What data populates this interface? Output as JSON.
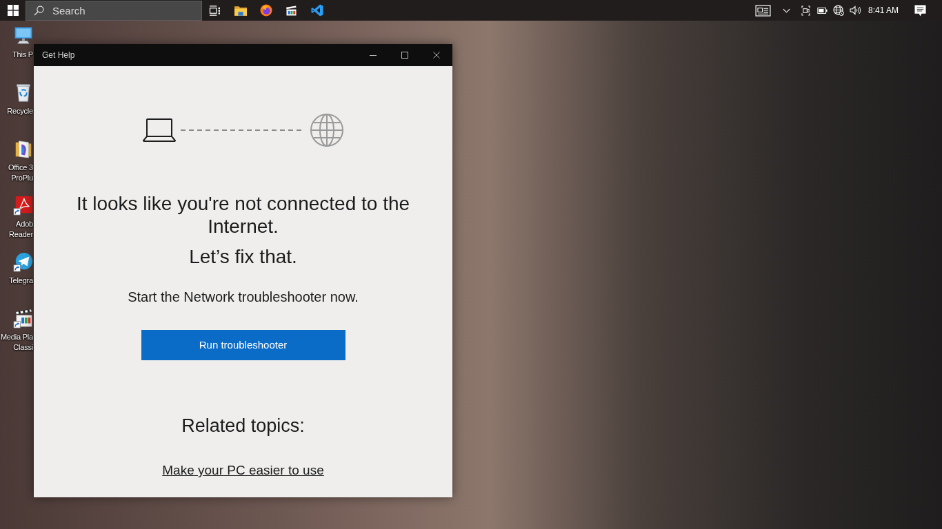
{
  "taskbar": {
    "search": {
      "placeholder": "Search"
    },
    "clock": "8:41 AM"
  },
  "desktop_icons": [
    {
      "kind": "computer",
      "lines": [
        "This P"
      ]
    },
    {
      "kind": "bin",
      "lines": [
        "Recycle"
      ]
    },
    {
      "kind": "office",
      "lines": [
        "Office 3",
        "ProPlu"
      ]
    },
    {
      "kind": "pdf",
      "lines": [
        "Adob",
        "Reader"
      ]
    },
    {
      "kind": "telegram",
      "lines": [
        "Telegra"
      ]
    },
    {
      "kind": "player",
      "lines": [
        "Media Pla",
        "Classi"
      ]
    }
  ],
  "window": {
    "title": "Get Help",
    "heading": "It looks like you're not connected to the Internet.",
    "subheading": "Let’s fix that.",
    "prompt": "Start the Network troubleshooter now.",
    "button": "Run troubleshooter",
    "related_title": "Related topics:",
    "related_links": [
      "Make your PC easier to use"
    ]
  }
}
